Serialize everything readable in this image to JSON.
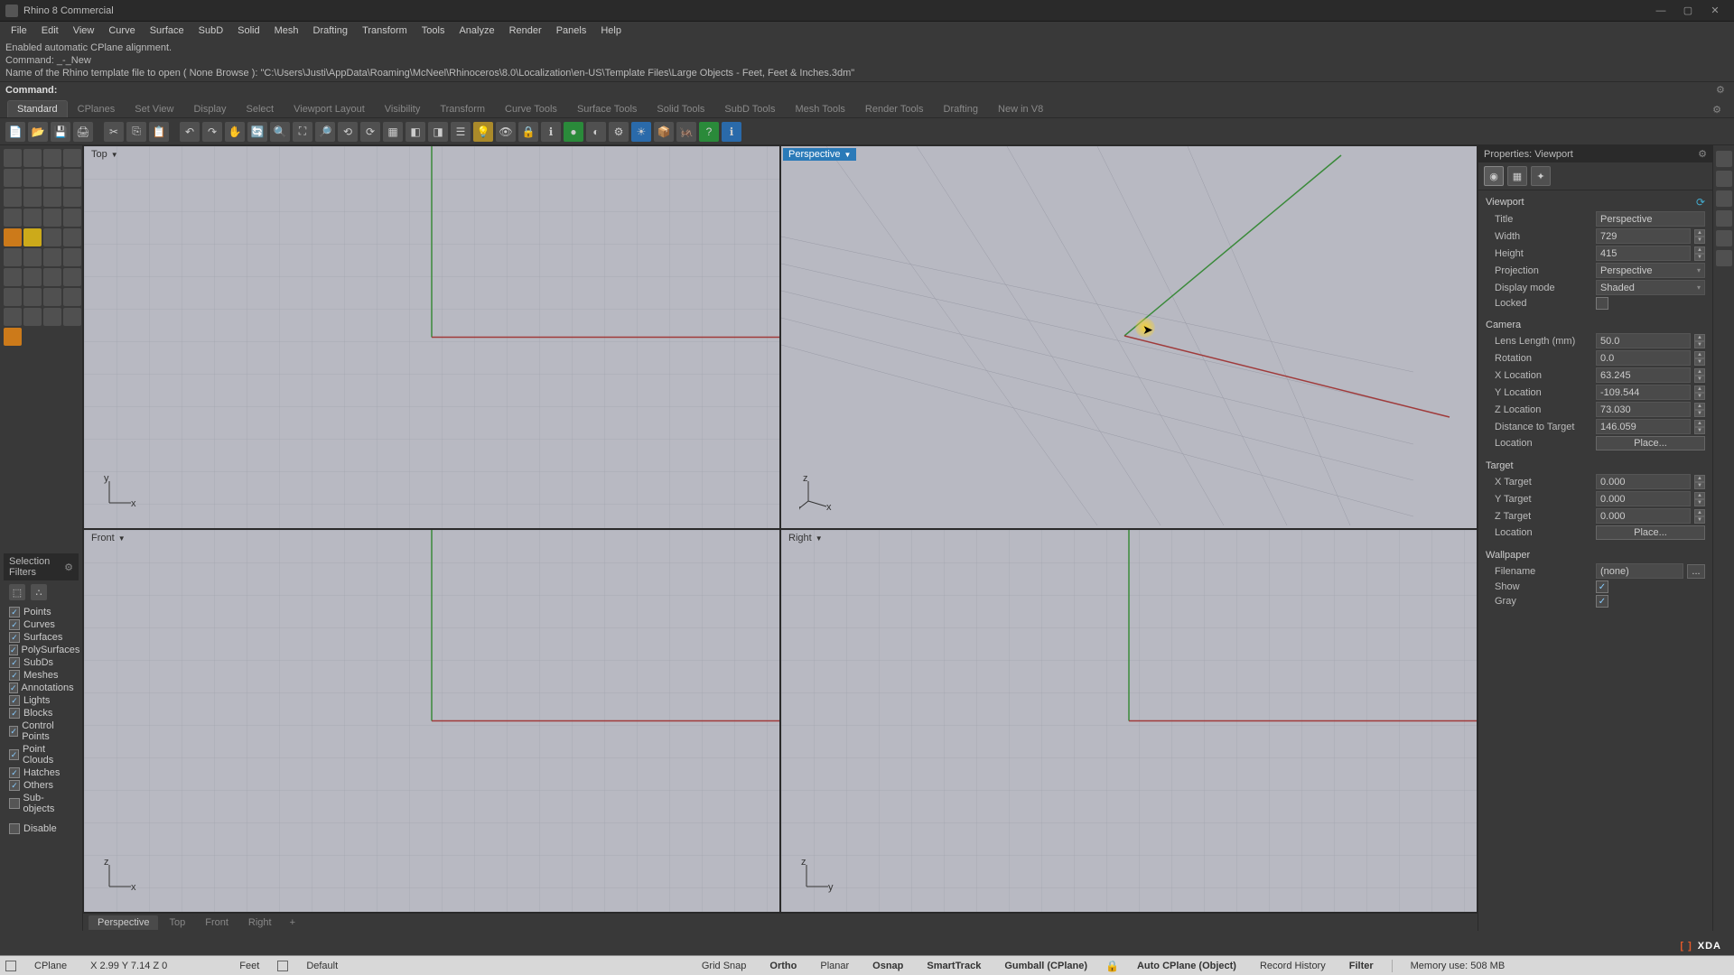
{
  "titlebar": {
    "title": "Rhino 8 Commercial"
  },
  "menu": [
    "File",
    "Edit",
    "View",
    "Curve",
    "Surface",
    "SubD",
    "Solid",
    "Mesh",
    "Drafting",
    "Transform",
    "Tools",
    "Analyze",
    "Render",
    "Panels",
    "Help"
  ],
  "cmd_history": [
    "Enabled automatic CPlane alignment.",
    "Command: _-_New",
    "Name of the Rhino template file to open ( None  Browse ): \"C:\\Users\\Justi\\AppData\\Roaming\\McNeel\\Rhinoceros\\8.0\\Localization\\en-US\\Template Files\\Large Objects - Feet, Feet & Inches.3dm\""
  ],
  "cmd_prompt": "Command:",
  "toolbar_tabs": [
    "Standard",
    "CPlanes",
    "Set View",
    "Display",
    "Select",
    "Viewport Layout",
    "Visibility",
    "Transform",
    "Curve Tools",
    "Surface Tools",
    "Solid Tools",
    "SubD Tools",
    "Mesh Tools",
    "Render Tools",
    "Drafting",
    "New in V8"
  ],
  "toolbar_tabs_active": 0,
  "selection_filters": {
    "title": "Selection Filters",
    "items": [
      {
        "label": "Points",
        "checked": true
      },
      {
        "label": "Curves",
        "checked": true
      },
      {
        "label": "Surfaces",
        "checked": true
      },
      {
        "label": "PolySurfaces",
        "checked": true
      },
      {
        "label": "SubDs",
        "checked": true
      },
      {
        "label": "Meshes",
        "checked": true
      },
      {
        "label": "Annotations",
        "checked": true
      },
      {
        "label": "Lights",
        "checked": true
      },
      {
        "label": "Blocks",
        "checked": true
      },
      {
        "label": "Control Points",
        "checked": true
      },
      {
        "label": "Point Clouds",
        "checked": true
      },
      {
        "label": "Hatches",
        "checked": true
      },
      {
        "label": "Others",
        "checked": true
      },
      {
        "label": "Sub-objects",
        "checked": false
      },
      {
        "label": "Disable",
        "checked": false
      }
    ]
  },
  "viewports": {
    "top": {
      "label": "Top",
      "axes": [
        "y",
        "x"
      ]
    },
    "persp": {
      "label": "Perspective",
      "axes": [
        "z",
        "y",
        "x"
      ],
      "active": true
    },
    "front": {
      "label": "Front",
      "axes": [
        "z",
        "x"
      ]
    },
    "right": {
      "label": "Right",
      "axes": [
        "z",
        "y"
      ]
    }
  },
  "viewtabs": [
    "Perspective",
    "Top",
    "Front",
    "Right"
  ],
  "properties": {
    "panel_title": "Properties: Viewport",
    "sections": {
      "viewport_title": "Viewport",
      "camera_title": "Camera",
      "target_title": "Target",
      "wallpaper_title": "Wallpaper"
    },
    "viewport": {
      "title_label": "Title",
      "title_val": "Perspective",
      "width_label": "Width",
      "width_val": "729",
      "height_label": "Height",
      "height_val": "415",
      "proj_label": "Projection",
      "proj_val": "Perspective",
      "disp_label": "Display mode",
      "disp_val": "Shaded",
      "locked_label": "Locked",
      "locked_val": false
    },
    "camera": {
      "lens_label": "Lens Length (mm)",
      "lens_val": "50.0",
      "rot_label": "Rotation",
      "rot_val": "0.0",
      "x_label": "X Location",
      "x_val": "63.245",
      "y_label": "Y Location",
      "y_val": "-109.544",
      "z_label": "Z Location",
      "z_val": "73.030",
      "dist_label": "Distance to Target",
      "dist_val": "146.059",
      "loc_label": "Location",
      "loc_btn": "Place..."
    },
    "target": {
      "x_label": "X Target",
      "x_val": "0.000",
      "y_label": "Y Target",
      "y_val": "0.000",
      "z_label": "Z Target",
      "z_val": "0.000",
      "loc_label": "Location",
      "loc_btn": "Place..."
    },
    "wallpaper": {
      "file_label": "Filename",
      "file_val": "(none)",
      "browse": "...",
      "show_label": "Show",
      "show_val": true,
      "gray_label": "Gray",
      "gray_val": true
    }
  },
  "statusbar": {
    "cplane": "CPlane",
    "coords": "X 2.99 Y 7.14 Z 0",
    "units": "Feet",
    "layer": "Default",
    "toggles": [
      "Grid Snap",
      "Ortho",
      "Planar",
      "Osnap",
      "SmartTrack",
      "Gumball (CPlane)",
      "Auto CPlane (Object)",
      "Record History",
      "Filter"
    ],
    "toggles_bold": [
      false,
      true,
      false,
      true,
      true,
      true,
      false,
      true,
      false,
      true
    ],
    "mem": "Memory use: 508 MB"
  },
  "watermark": "XDA"
}
